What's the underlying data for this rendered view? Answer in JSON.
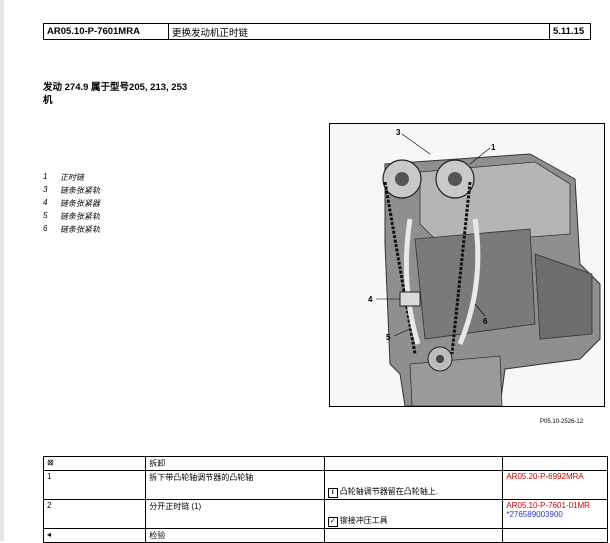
{
  "header": {
    "doc_code": "AR05.10-P-7601MRA",
    "title": "更换发动机正时链",
    "version": "5.11.15"
  },
  "engine": {
    "line1": "发动 274.9 属于型号205, 213, 253",
    "line2": "机"
  },
  "legend": [
    {
      "num": "1",
      "label": "正时链"
    },
    {
      "num": "3",
      "label": "链条张紧轨"
    },
    {
      "num": "4",
      "label": "链条张紧器"
    },
    {
      "num": "5",
      "label": "链条张紧轨"
    },
    {
      "num": "6",
      "label": "链条张紧轨"
    }
  ],
  "figure": {
    "callouts": [
      "3",
      "1",
      "4",
      "5",
      "6"
    ],
    "ref": "P05.10-2526-12"
  },
  "steps": {
    "header": {
      "col2": "拆卸"
    },
    "rows": [
      {
        "num": "1",
        "action": "拆下带凸轮轴调节器的凸轮轴",
        "note": "凸轮轴调节器留在凸轮轴上.",
        "note_icon": "i",
        "ref1": "AR05.20-P-6992MRA",
        "ref2": ""
      },
      {
        "num": "2",
        "action": "分开正时链 (1)",
        "note": "铆接冲压工具",
        "note_icon": "✓",
        "ref1": "AR05.10-P-7601-01MR",
        "ref2": "*276589003900"
      }
    ],
    "footer": {
      "col2": "检验"
    }
  }
}
